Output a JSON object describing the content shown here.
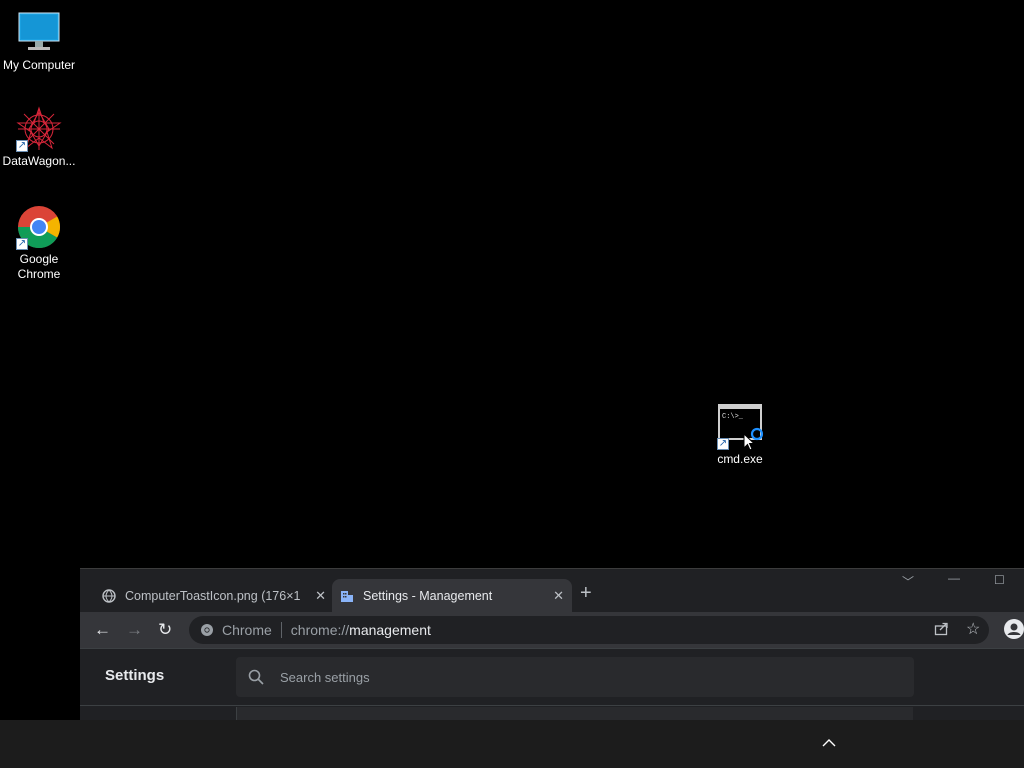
{
  "desktop": {
    "icons": [
      {
        "label": "My Computer"
      },
      {
        "label": "DataWagon..."
      },
      {
        "label": "Google\nChrome"
      },
      {
        "label": "cmd.exe"
      }
    ],
    "cmd_prompt_text": "C:\\>_"
  },
  "browser": {
    "tabs": [
      {
        "title": "ComputerToastIcon.png (176×1",
        "close": "✕"
      },
      {
        "title": "Settings - Management",
        "close": "✕"
      }
    ],
    "new_tab": "+",
    "address": {
      "scheme_label": "Chrome",
      "prefix": "chrome://",
      "host": "management"
    },
    "page": {
      "title": "Settings",
      "search_placeholder": "Search settings"
    }
  },
  "colors": {
    "desktop_bg": "#000000",
    "browser_bg": "#202124",
    "toolbar_bg": "#35363a",
    "taskbar_bg": "#1c1c1c"
  }
}
